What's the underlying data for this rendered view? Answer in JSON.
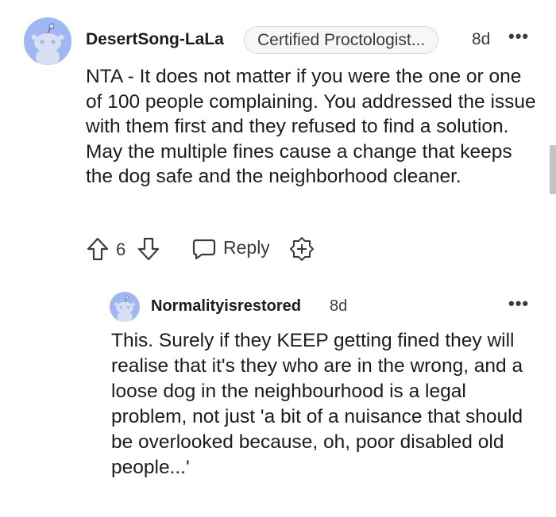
{
  "comment": {
    "username": "DesertSong-LaLa",
    "flair": "Certified Proctologist...",
    "time": "8d",
    "more": "•••",
    "body": "NTA - It does not matter if you were the one or one of 100 people complaining. You addressed the issue with them first and they refused to find a solution. May the multiple fines cause a change that keeps the dog safe and the neighborhood cleaner.",
    "score": "6",
    "reply_label": "Reply"
  },
  "reply": {
    "username": "Normalityisrestored",
    "time": "8d",
    "more": "•••",
    "body": "This. Surely if they KEEP getting fined they will realise that it's they who are in the wrong, and a loose dog in the neighbourhood is a legal problem, not just 'a bit of a nuisance that should be overlooked because, oh, poor disabled old people...'"
  },
  "icons": {
    "avatar": "snoo-avatar-icon",
    "upvote": "upvote-arrow-icon",
    "downvote": "downvote-arrow-icon",
    "reply": "speech-bubble-icon",
    "award": "award-plus-icon"
  },
  "colors": {
    "avatar_bg": "#9fb7f5",
    "text": "#1c1c1c",
    "muted": "#3c3c3c",
    "flair_border": "#d7d9dc"
  }
}
